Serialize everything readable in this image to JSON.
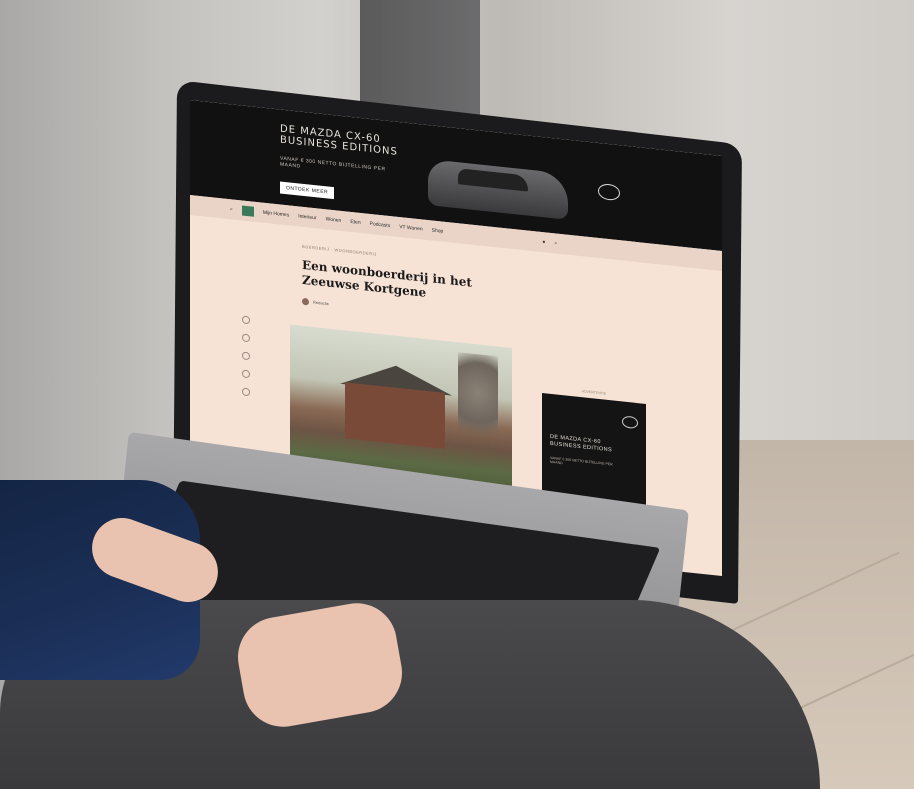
{
  "ad_top": {
    "headline": "DE MAZDA CX-60 BUSINESS EDITIONS",
    "subline": "VANAF € 300 NETTO BIJTELLING PER MAAND",
    "button": "ONTDEK MEER"
  },
  "nav": {
    "items": [
      "Mijn Homes",
      "Interieur",
      "Wonen",
      "Eten",
      "Podcasts",
      "VT Wonen",
      "Shop"
    ]
  },
  "article": {
    "category": "BOERDERIJ · WOONBOERDERIJ",
    "title": "Een woonboerderij in het Zeeuwse Kortgene",
    "author": "Redactie"
  },
  "side_ad": {
    "label": "ADVERTENTIE",
    "headline": "DE MAZDA CX-60 BUSINESS EDITIONS",
    "subline": "VANAF € 300 NETTO BIJTELLING PER MAAND"
  }
}
